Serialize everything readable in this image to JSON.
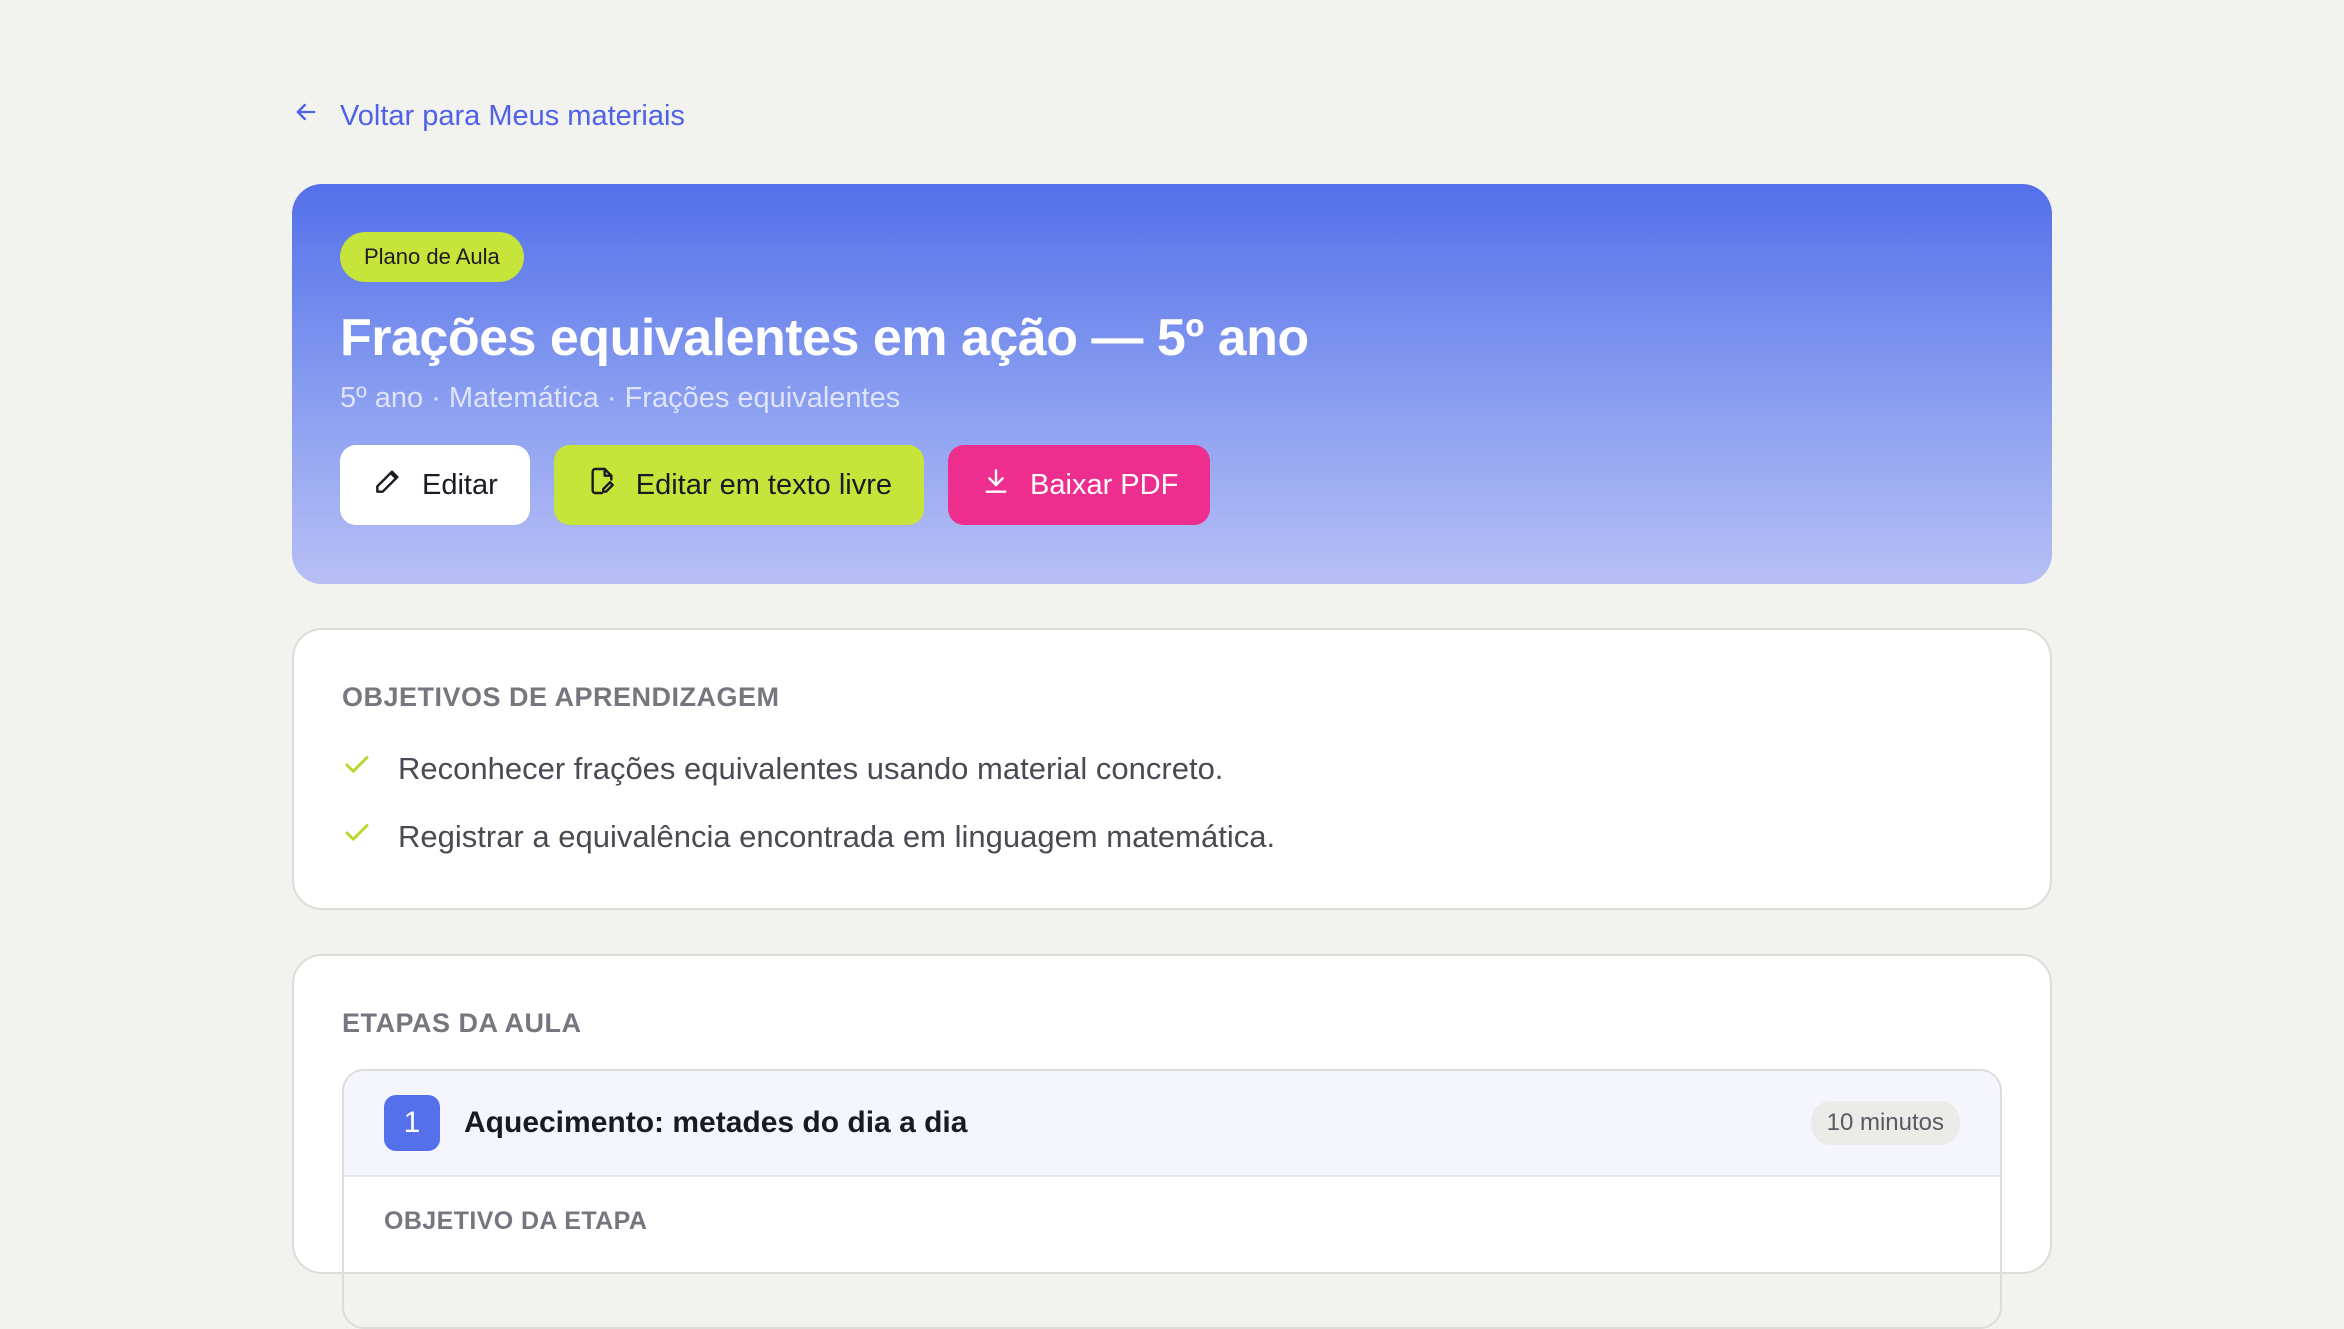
{
  "back_link": {
    "label": "Voltar para Meus materiais",
    "icon": "arrow-left-icon"
  },
  "hero": {
    "badge": "Plano de Aula",
    "title": "Frações equivalentes em ação — 5º ano",
    "subtitle": "5º ano · Matemática · Frações equivalentes",
    "actions": {
      "edit": "Editar",
      "edit_free_text": "Editar em texto livre",
      "download_pdf": "Baixar PDF"
    }
  },
  "objectives": {
    "title": "OBJETIVOS DE APRENDIZAGEM",
    "items": [
      "Reconhecer frações equivalentes usando material concreto.",
      "Registrar a equivalência encontrada em linguagem matemática."
    ]
  },
  "steps": {
    "title": "ETAPAS DA AULA",
    "items": [
      {
        "number": "1",
        "title": "Aquecimento: metades do dia a dia",
        "duration": "10 minutos",
        "objective_label": "OBJETIVO DA ETAPA"
      }
    ]
  },
  "colors": {
    "accent": "#5470ea",
    "lime": "#c6e43a",
    "pink": "#ee2e8f",
    "background": "#f2f2ef"
  }
}
